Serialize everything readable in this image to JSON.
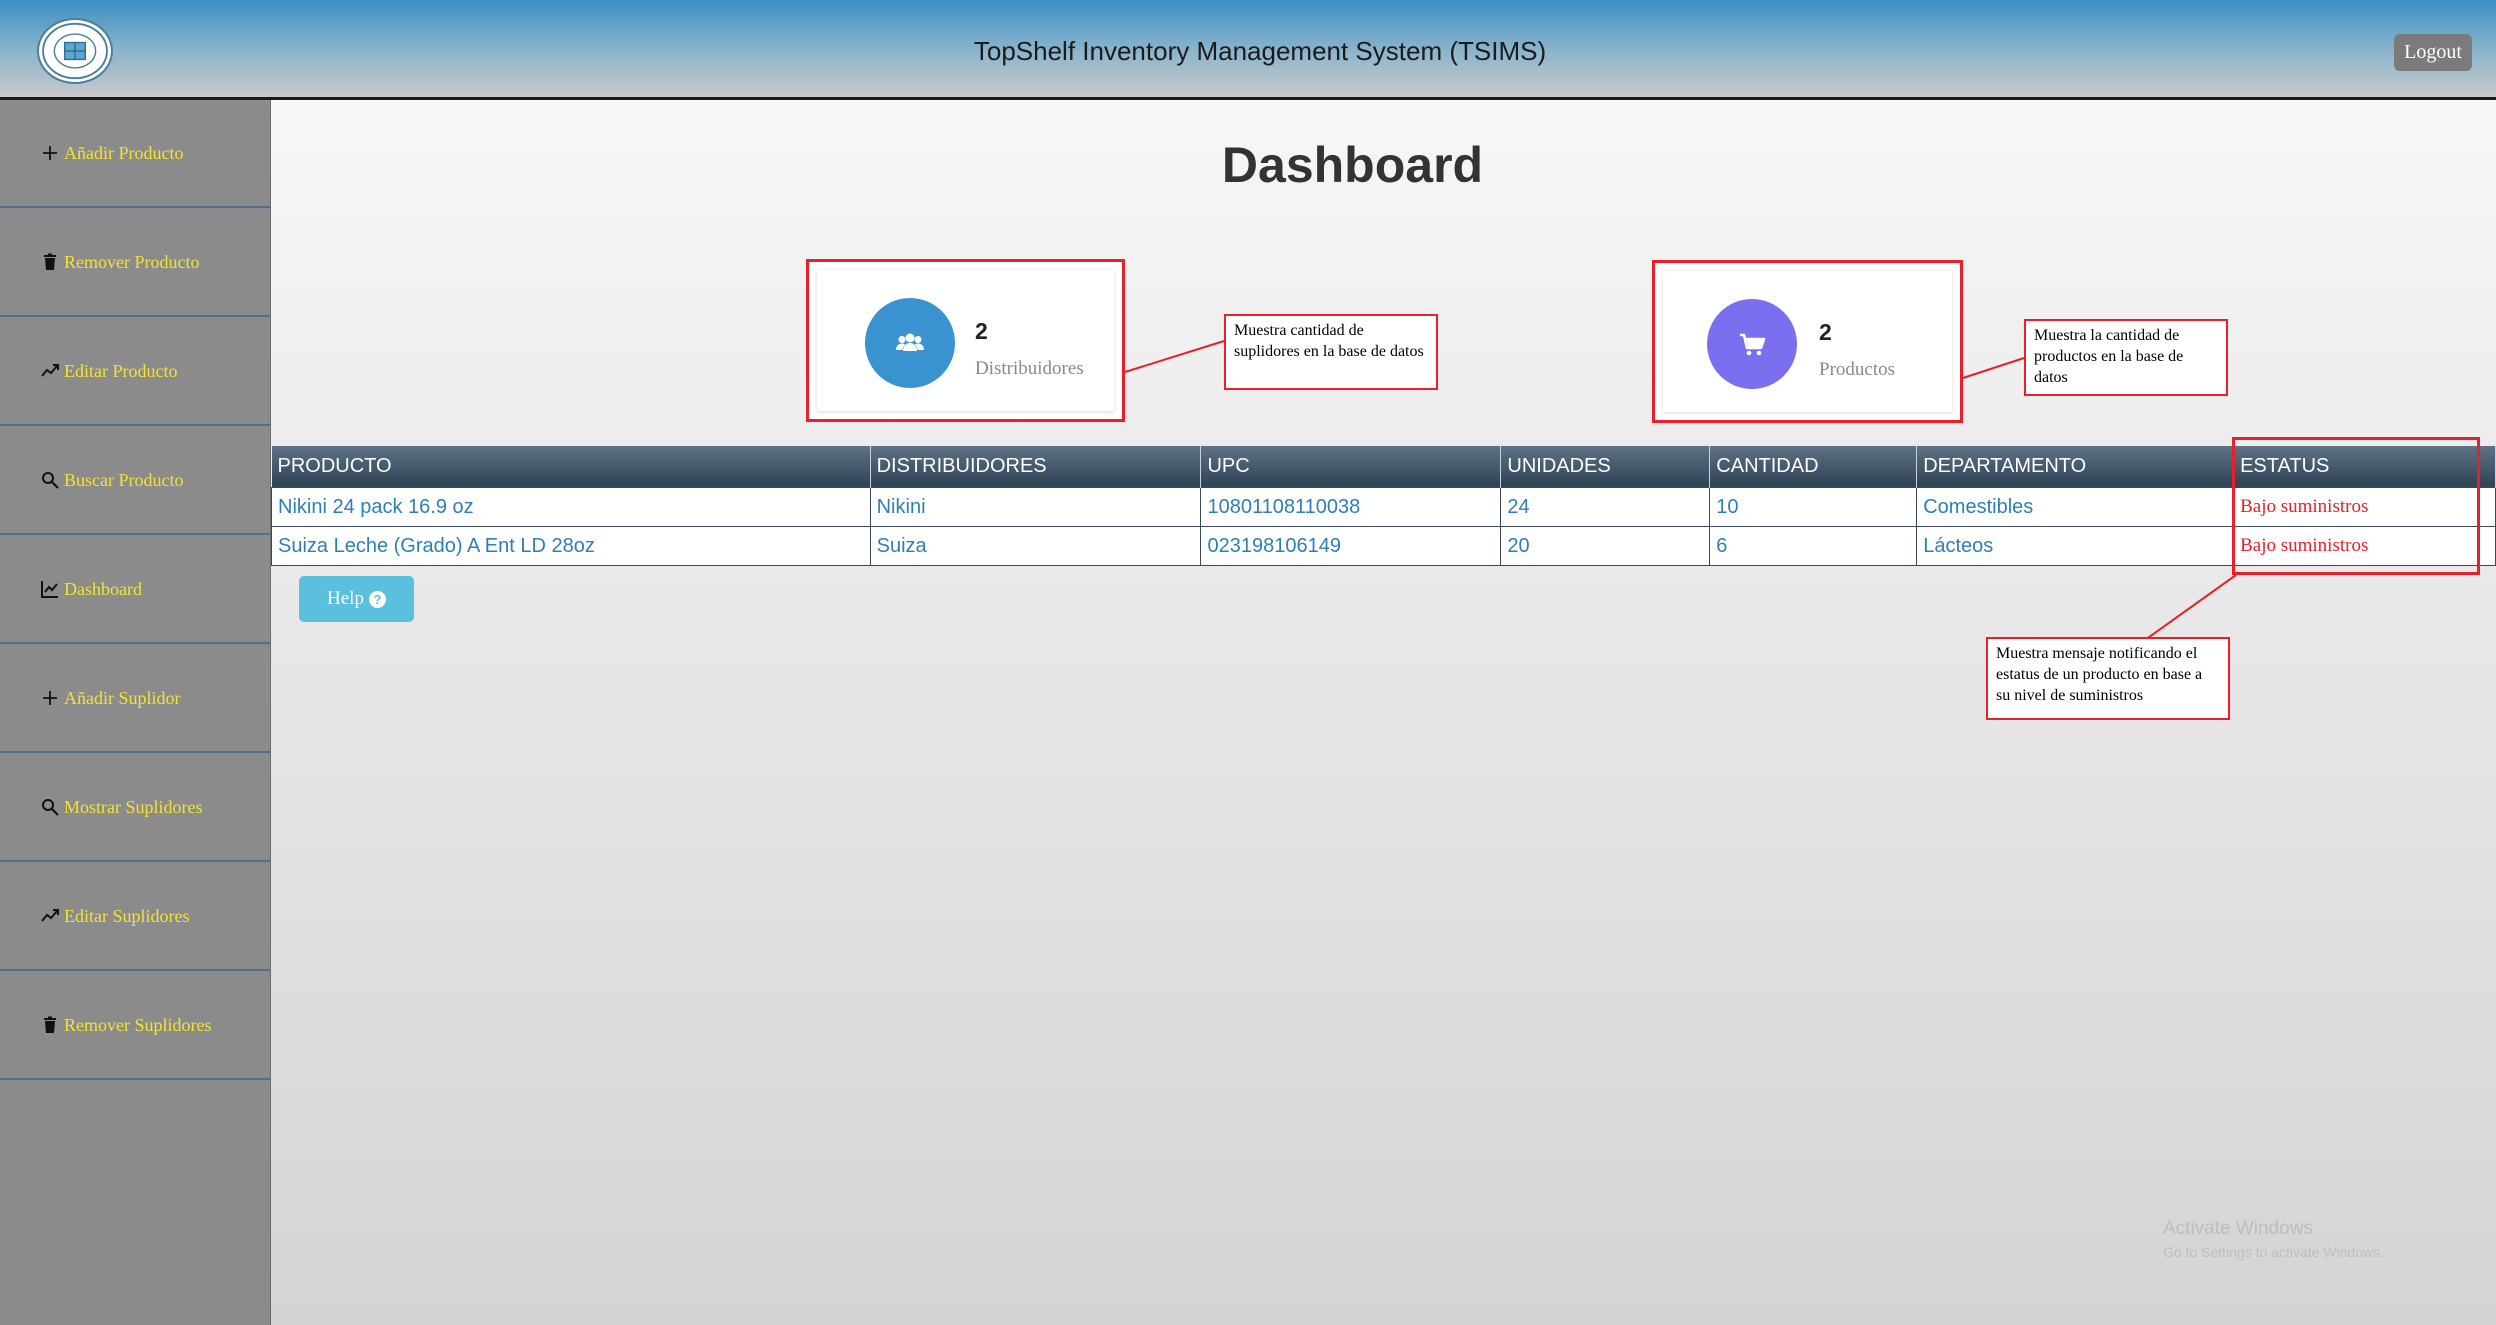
{
  "header": {
    "title": "TopShelf Inventory Management System (TSIMS)",
    "logo_icon": "shelf-logo",
    "logout_label": "Logout"
  },
  "sidebar": {
    "items": [
      {
        "label": "Añadir Producto",
        "icon": "plus-icon"
      },
      {
        "label": "Remover Producto",
        "icon": "trash-icon"
      },
      {
        "label": "Editar Producto",
        "icon": "trend-up-icon"
      },
      {
        "label": "Buscar Producto",
        "icon": "search-icon"
      },
      {
        "label": "Dashboard",
        "icon": "chart-line-icon"
      },
      {
        "label": "Añadir Suplidor",
        "icon": "plus-icon"
      },
      {
        "label": "Mostrar Suplidores",
        "icon": "search-icon"
      },
      {
        "label": "Editar Suplidores",
        "icon": "trend-up-icon"
      },
      {
        "label": "Remover Suplidores",
        "icon": "trash-icon"
      }
    ]
  },
  "main": {
    "page_title": "Dashboard",
    "cards": [
      {
        "count": "2",
        "label": "Distribuidores",
        "icon": "users-icon",
        "color": "#3a93d0"
      },
      {
        "count": "2",
        "label": "Productos",
        "icon": "cart-icon",
        "color": "#7b6ff0"
      }
    ],
    "notes": {
      "distribuidores": "Muestra cantidad de suplidores en la base de datos",
      "productos": "Muestra la cantidad de productos en la base de datos",
      "estatus": "Muestra mensaje notificando el estatus de un producto en base a su nivel de suministros"
    },
    "table": {
      "headers": [
        "PRODUCTO",
        "DISTRIBUIDORES",
        "UPC",
        "UNIDADES",
        "CANTIDAD",
        "DEPARTAMENTO",
        "ESTATUS"
      ],
      "rows": [
        [
          "Nikini 24 pack 16.9 oz",
          "Nikini",
          "10801108110038",
          "24",
          "10",
          "Comestibles",
          "Bajo suministros"
        ],
        [
          "Suiza Leche (Grado) A Ent LD 28oz",
          "Suiza",
          "023198106149",
          "20",
          "6",
          "Lácteos",
          "Bajo suministros"
        ]
      ]
    },
    "help_label": "Help"
  },
  "watermark": {
    "line1": "Activate Windows",
    "line2": "Go to Settings to activate Windows."
  },
  "colors": {
    "sidebar_text": "#f2e332",
    "status_red": "#e8202a",
    "link_blue": "#2e7fb7",
    "help_button": "#5bc0de"
  }
}
